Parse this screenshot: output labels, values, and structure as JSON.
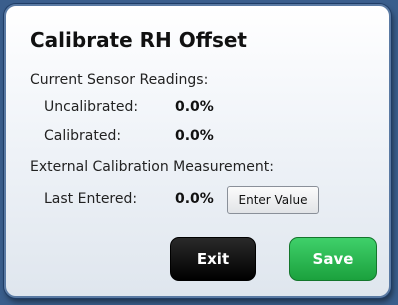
{
  "dialog": {
    "title": "Calibrate RH Offset",
    "current_readings_heading": "Current Sensor Readings:",
    "uncalibrated": {
      "label": "Uncalibrated:",
      "value": "0.0%"
    },
    "calibrated": {
      "label": "Calibrated:",
      "value": "0.0%"
    },
    "external_heading": "External Calibration Measurement:",
    "last_entered": {
      "label": "Last Entered:",
      "value": "0.0%"
    },
    "enter_value_label": "Enter Value",
    "exit_label": "Exit",
    "save_label": "Save"
  },
  "colors": {
    "exit_button": "#000000",
    "save_button": "#22b04a"
  }
}
